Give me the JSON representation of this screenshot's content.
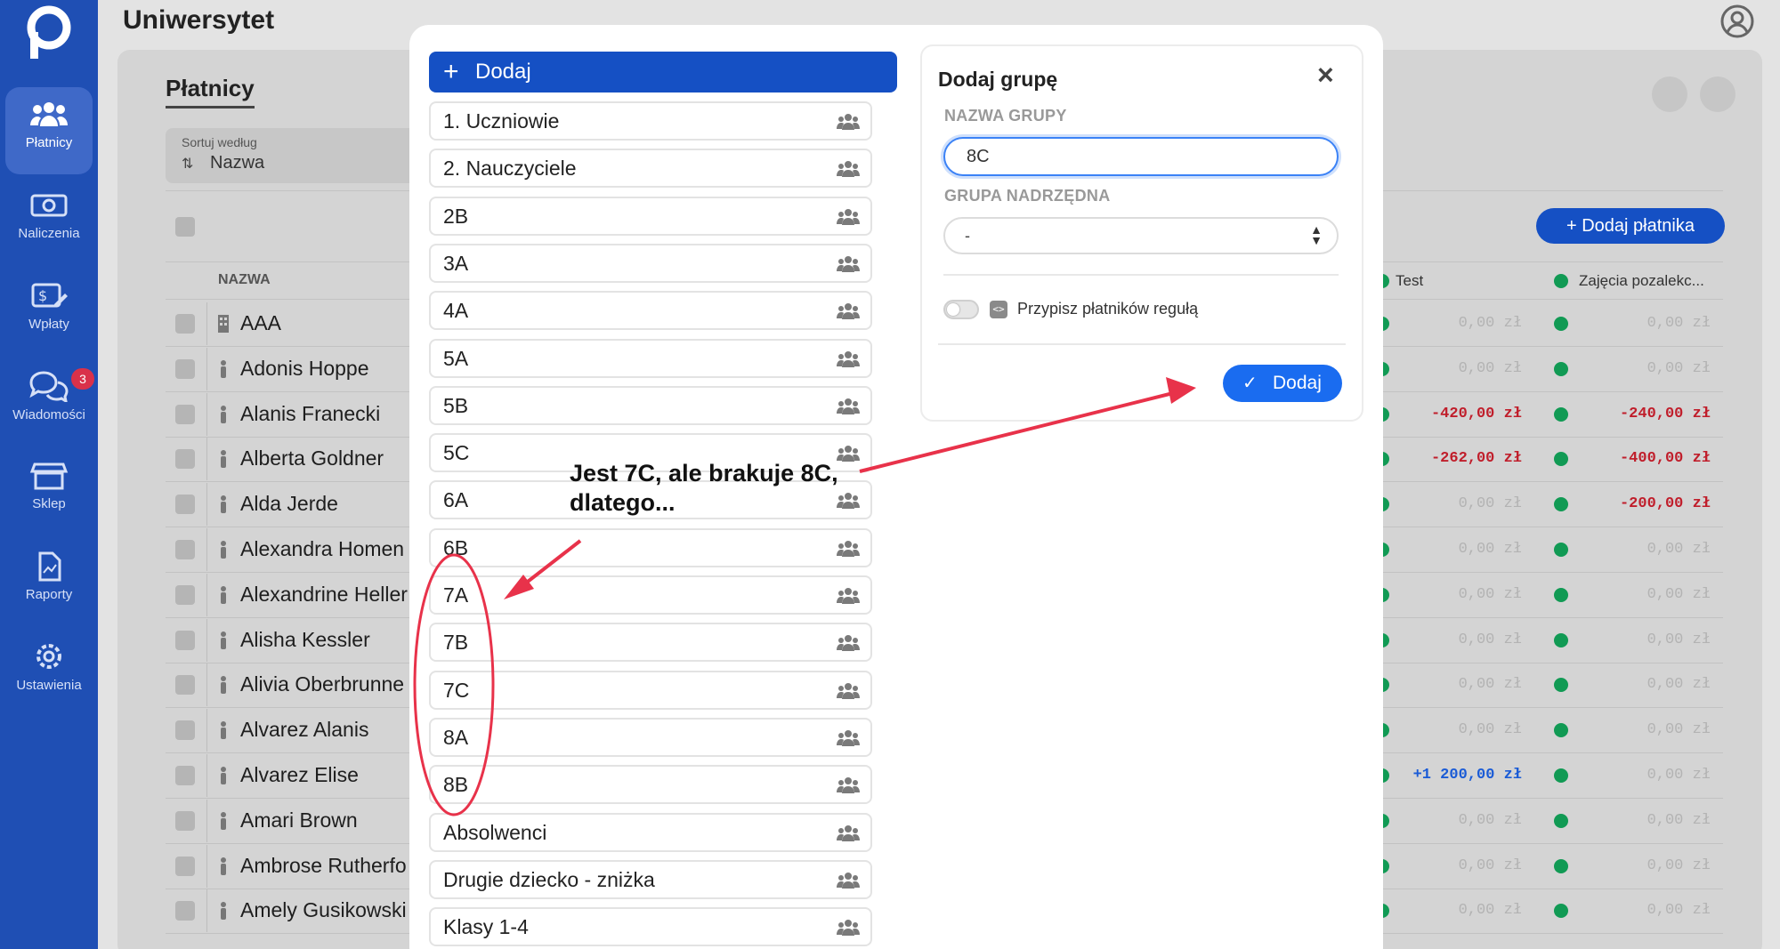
{
  "app": {
    "title": "Uniwersytet"
  },
  "sidebar": {
    "items": [
      {
        "label": "Płatnicy",
        "icon": "users-icon",
        "active": true
      },
      {
        "label": "Naliczenia",
        "icon": "money-icon"
      },
      {
        "label": "Wpłaty",
        "icon": "payment-icon"
      },
      {
        "label": "Wiadomości",
        "icon": "chat-icon",
        "badge": "3"
      },
      {
        "label": "Sklep",
        "icon": "shop-icon"
      },
      {
        "label": "Raporty",
        "icon": "report-icon"
      },
      {
        "label": "Ustawienia",
        "icon": "gear-icon"
      }
    ]
  },
  "payers": {
    "title": "Płatnicy",
    "sort_label": "Sortuj według",
    "sort_value": "Nazwa",
    "column_name": "NAZWA",
    "add_payer_label": "+ Dodaj płatnika",
    "col_test": "Test",
    "col_extra": "Zajęcia pozalekc...",
    "rows": [
      {
        "name": "AAA",
        "test": "0,00 zł",
        "extra": "0,00 zł"
      },
      {
        "name": "Adonis Hoppe",
        "test": "0,00 zł",
        "extra": "0,00 zł"
      },
      {
        "name": "Alanis Franecki",
        "test": "-420,00 zł",
        "extra": "-240,00 zł"
      },
      {
        "name": "Alberta Goldner",
        "test": "-262,00 zł",
        "extra": "-400,00 zł"
      },
      {
        "name": "Alda Jerde",
        "test": "0,00 zł",
        "extra": "-200,00 zł"
      },
      {
        "name": "Alexandra Homen",
        "test": "0,00 zł",
        "extra": "0,00 zł"
      },
      {
        "name": "Alexandrine Heller",
        "test": "0,00 zł",
        "extra": "0,00 zł"
      },
      {
        "name": "Alisha Kessler",
        "test": "0,00 zł",
        "extra": "0,00 zł"
      },
      {
        "name": "Alivia Oberbrunne",
        "test": "0,00 zł",
        "extra": "0,00 zł"
      },
      {
        "name": "Alvarez Alanis",
        "test": "0,00 zł",
        "extra": "0,00 zł"
      },
      {
        "name": "Alvarez Elise",
        "test": "+1 200,00 zł",
        "extra": "0,00 zł"
      },
      {
        "name": "Amari Brown",
        "test": "0,00 zł",
        "extra": "0,00 zł"
      },
      {
        "name": "Ambrose Rutherfo",
        "test": "0,00 zł",
        "extra": "0,00 zł"
      },
      {
        "name": "Amely Gusikowski",
        "test": "0,00 zł",
        "extra": "0,00 zł"
      }
    ]
  },
  "groups": {
    "add_label": "Dodaj",
    "items": [
      "1. Uczniowie",
      "2. Nauczyciele",
      "2B",
      "3A",
      "4A",
      "5A",
      "5B",
      "5C",
      "6A",
      "6B",
      "7A",
      "7B",
      "7C",
      "8A",
      "8B",
      "Absolwenci",
      "Drugie dziecko - zniżka",
      "Klasy 1-4"
    ]
  },
  "form": {
    "title": "Dodaj grupę",
    "name_label": "NAZWA GRUPY",
    "name_value": "8C",
    "parent_label": "GRUPA NADRZĘDNA",
    "parent_value": "-",
    "rule_label": "Przypisz płatników regułą",
    "submit_label": "Dodaj"
  },
  "annotation": {
    "line1": "Jest 7C, ale brakuje 8C,",
    "line2": "dlatego..."
  },
  "colors": {
    "sidebar": "#1f4fb4",
    "primary": "#1550c4",
    "annotation": "#e8324a"
  }
}
